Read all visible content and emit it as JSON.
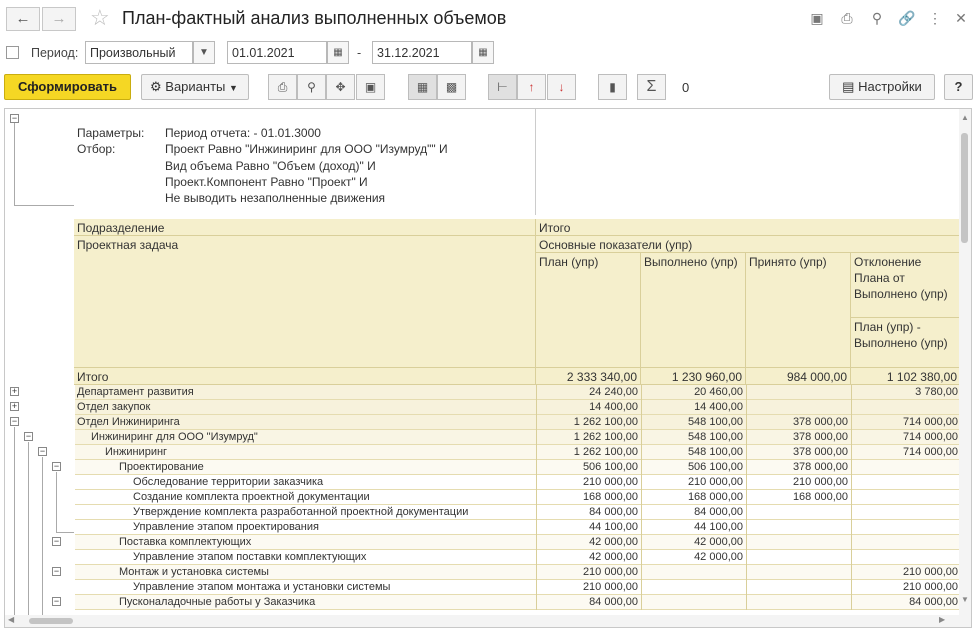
{
  "title": "План-фактный анализ выполненных объемов",
  "period": {
    "label": "Период:",
    "mode": "Произвольный",
    "from": "01.01.2021",
    "dash": "-",
    "to": "31.12.2021"
  },
  "toolbar": {
    "generate": "Сформировать",
    "variants": "Варианты",
    "sum_value": "0",
    "settings": "Настройки",
    "help": "?"
  },
  "params": {
    "params_label": "Параметры:",
    "period_text": "Период отчета:  - 01.01.3000",
    "filter_label": "Отбор:",
    "filter_lines": [
      "Проект Равно \"Инжиниринг для ООО \"Изумруд\"\" И",
      "Вид объема Равно \"Объем (доход)\" И",
      "Проект.Компонент Равно \"Проект\" И",
      "Не выводить незаполненные движения"
    ]
  },
  "header": {
    "dept": "Подразделение",
    "task": "Проектная задача",
    "total": "Итого",
    "main": "Основные показатели (упр)",
    "plan": "План (упр)",
    "done": "Выполнено (упр)",
    "accepted": "Принято (упр)",
    "deviation": "Отклонение Плана от Выполнено (упр)",
    "deviation_sub": "План (упр) - Выполнено (упр)"
  },
  "total_row": {
    "label": "Итого",
    "plan": "2 333 340,00",
    "done": "1 230 960,00",
    "accepted": "984 000,00",
    "dev": "1 102 380,00"
  },
  "rows": [
    {
      "label": "Департамент развития",
      "plan": "24 240,00",
      "done": "20 460,00",
      "accepted": "",
      "dev": "3 780,00"
    },
    {
      "label": "Отдел закупок",
      "plan": "14 400,00",
      "done": "14 400,00",
      "accepted": "",
      "dev": ""
    },
    {
      "label": "Отдел Инжиниринга",
      "plan": "1 262 100,00",
      "done": "548 100,00",
      "accepted": "378 000,00",
      "dev": "714 000,00"
    },
    {
      "label": "Инжиниринг для ООО \"Изумруд\"",
      "plan": "1 262 100,00",
      "done": "548 100,00",
      "accepted": "378 000,00",
      "dev": "714 000,00"
    },
    {
      "label": "Инжиниринг",
      "plan": "1 262 100,00",
      "done": "548 100,00",
      "accepted": "378 000,00",
      "dev": "714 000,00"
    },
    {
      "label": "Проектирование",
      "plan": "506 100,00",
      "done": "506 100,00",
      "accepted": "378 000,00",
      "dev": ""
    },
    {
      "label": "Обследование территории заказчика",
      "plan": "210 000,00",
      "done": "210 000,00",
      "accepted": "210 000,00",
      "dev": ""
    },
    {
      "label": "Создание комплекта проектной документации",
      "plan": "168 000,00",
      "done": "168 000,00",
      "accepted": "168 000,00",
      "dev": ""
    },
    {
      "label": "Утверждение комплекта разработанной проектной документации",
      "plan": "84 000,00",
      "done": "84 000,00",
      "accepted": "",
      "dev": ""
    },
    {
      "label": "Управление этапом проектирования",
      "plan": "44 100,00",
      "done": "44 100,00",
      "accepted": "",
      "dev": ""
    },
    {
      "label": "Поставка комплектующих",
      "plan": "42 000,00",
      "done": "42 000,00",
      "accepted": "",
      "dev": ""
    },
    {
      "label": "Управление этапом поставки комплектующих",
      "plan": "42 000,00",
      "done": "42 000,00",
      "accepted": "",
      "dev": ""
    },
    {
      "label": "Монтаж и установка системы",
      "plan": "210 000,00",
      "done": "",
      "accepted": "",
      "dev": "210 000,00"
    },
    {
      "label": "Управление этапом монтажа и установки системы",
      "plan": "210 000,00",
      "done": "",
      "accepted": "",
      "dev": "210 000,00"
    },
    {
      "label": "Пусконаладочные работы у Заказчика",
      "plan": "84 000,00",
      "done": "",
      "accepted": "",
      "dev": "84 000,00"
    }
  ]
}
